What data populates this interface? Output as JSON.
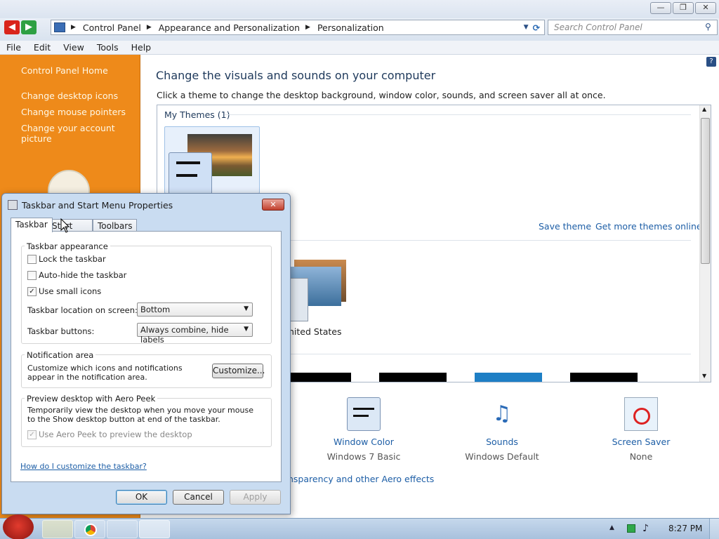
{
  "window": {
    "minimize": "—",
    "maximize": "❐",
    "close": "✕"
  },
  "nav": {
    "back": "◀",
    "forward": "▶"
  },
  "address": {
    "crumbs": [
      "Control Panel",
      "Appearance and Personalization",
      "Personalization"
    ],
    "search_placeholder": "Search Control Panel"
  },
  "menu": [
    "File",
    "Edit",
    "View",
    "Tools",
    "Help"
  ],
  "sidebar": {
    "home": "Control Panel Home",
    "links": [
      "Change desktop icons",
      "Change mouse pointers",
      "Change your account picture"
    ]
  },
  "main": {
    "heading": "Change the visuals and sounds on your computer",
    "subheading": "Click a theme to change the desktop background, window color, sounds, and screen saver all at once.",
    "my_themes": "My Themes (1)",
    "save_theme": "Save theme",
    "get_more": "Get more themes online",
    "partial_theme_label": "nited States",
    "aero_link": "nsparency and other Aero effects",
    "bottom_items": [
      {
        "title": "Window Color",
        "sub": "Windows 7 Basic"
      },
      {
        "title": "Sounds",
        "sub": "Windows Default"
      },
      {
        "title": "Screen Saver",
        "sub": "None"
      }
    ]
  },
  "dialog": {
    "title": "Taskbar and Start Menu Properties",
    "tabs": [
      "Taskbar",
      "Start Menu",
      "Toolbars"
    ],
    "appearance_group": "Taskbar appearance",
    "lock": "Lock the taskbar",
    "autohide": "Auto-hide the taskbar",
    "small_icons": "Use small icons",
    "location_label": "Taskbar location on screen:",
    "location_value": "Bottom",
    "buttons_label": "Taskbar buttons:",
    "buttons_value": "Always combine, hide labels",
    "notif_group": "Notification area",
    "notif_text": "Customize which icons and notifications appear in the notification area.",
    "customize": "Customize...",
    "peek_group": "Preview desktop with Aero Peek",
    "peek_text": "Temporarily view the desktop when you move your mouse to the Show desktop button at end of the taskbar.",
    "peek_check": "Use Aero Peek to preview the desktop",
    "help_link": "How do I customize the taskbar?",
    "ok": "OK",
    "cancel": "Cancel",
    "apply": "Apply",
    "check_mark": "✓"
  },
  "taskbar": {
    "clock": "8:27 PM",
    "tray_up": "▲"
  },
  "colors": {
    "sidebar": "#ee8a1a",
    "link": "#1d5ea6",
    "taskbar": "#b5cbe4"
  }
}
